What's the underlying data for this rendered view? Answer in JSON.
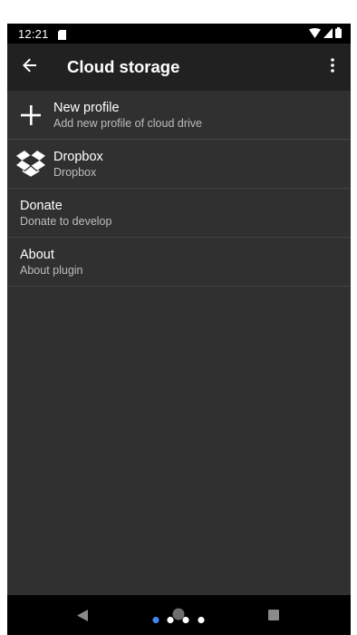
{
  "status_bar": {
    "time": "12:21",
    "icons": [
      "sd-card-icon",
      "wifi-icon",
      "signal-icon",
      "battery-icon"
    ]
  },
  "app_bar": {
    "title": "Cloud storage",
    "back_icon": "arrow-back-icon",
    "menu_icon": "more-vert-icon"
  },
  "list": {
    "items": [
      {
        "title": "New profile",
        "subtitle": "Add new profile of cloud drive",
        "icon": "plus-icon"
      },
      {
        "title": "Dropbox",
        "subtitle": "Dropbox",
        "icon": "dropbox-icon"
      },
      {
        "title": "Donate",
        "subtitle": "Donate to develop",
        "icon": ""
      },
      {
        "title": "About",
        "subtitle": "About plugin",
        "icon": ""
      }
    ]
  },
  "nav_bar": {
    "icons": [
      "nav-back-icon",
      "nav-home-icon",
      "nav-recents-icon"
    ]
  },
  "colors": {
    "background": "#303030",
    "app_bar": "#212121",
    "status_bar": "#000000",
    "divider": "#444444",
    "text_primary": "#ffffff",
    "text_secondary": "#bdbdbd",
    "accent_dot": "#4285f4"
  }
}
